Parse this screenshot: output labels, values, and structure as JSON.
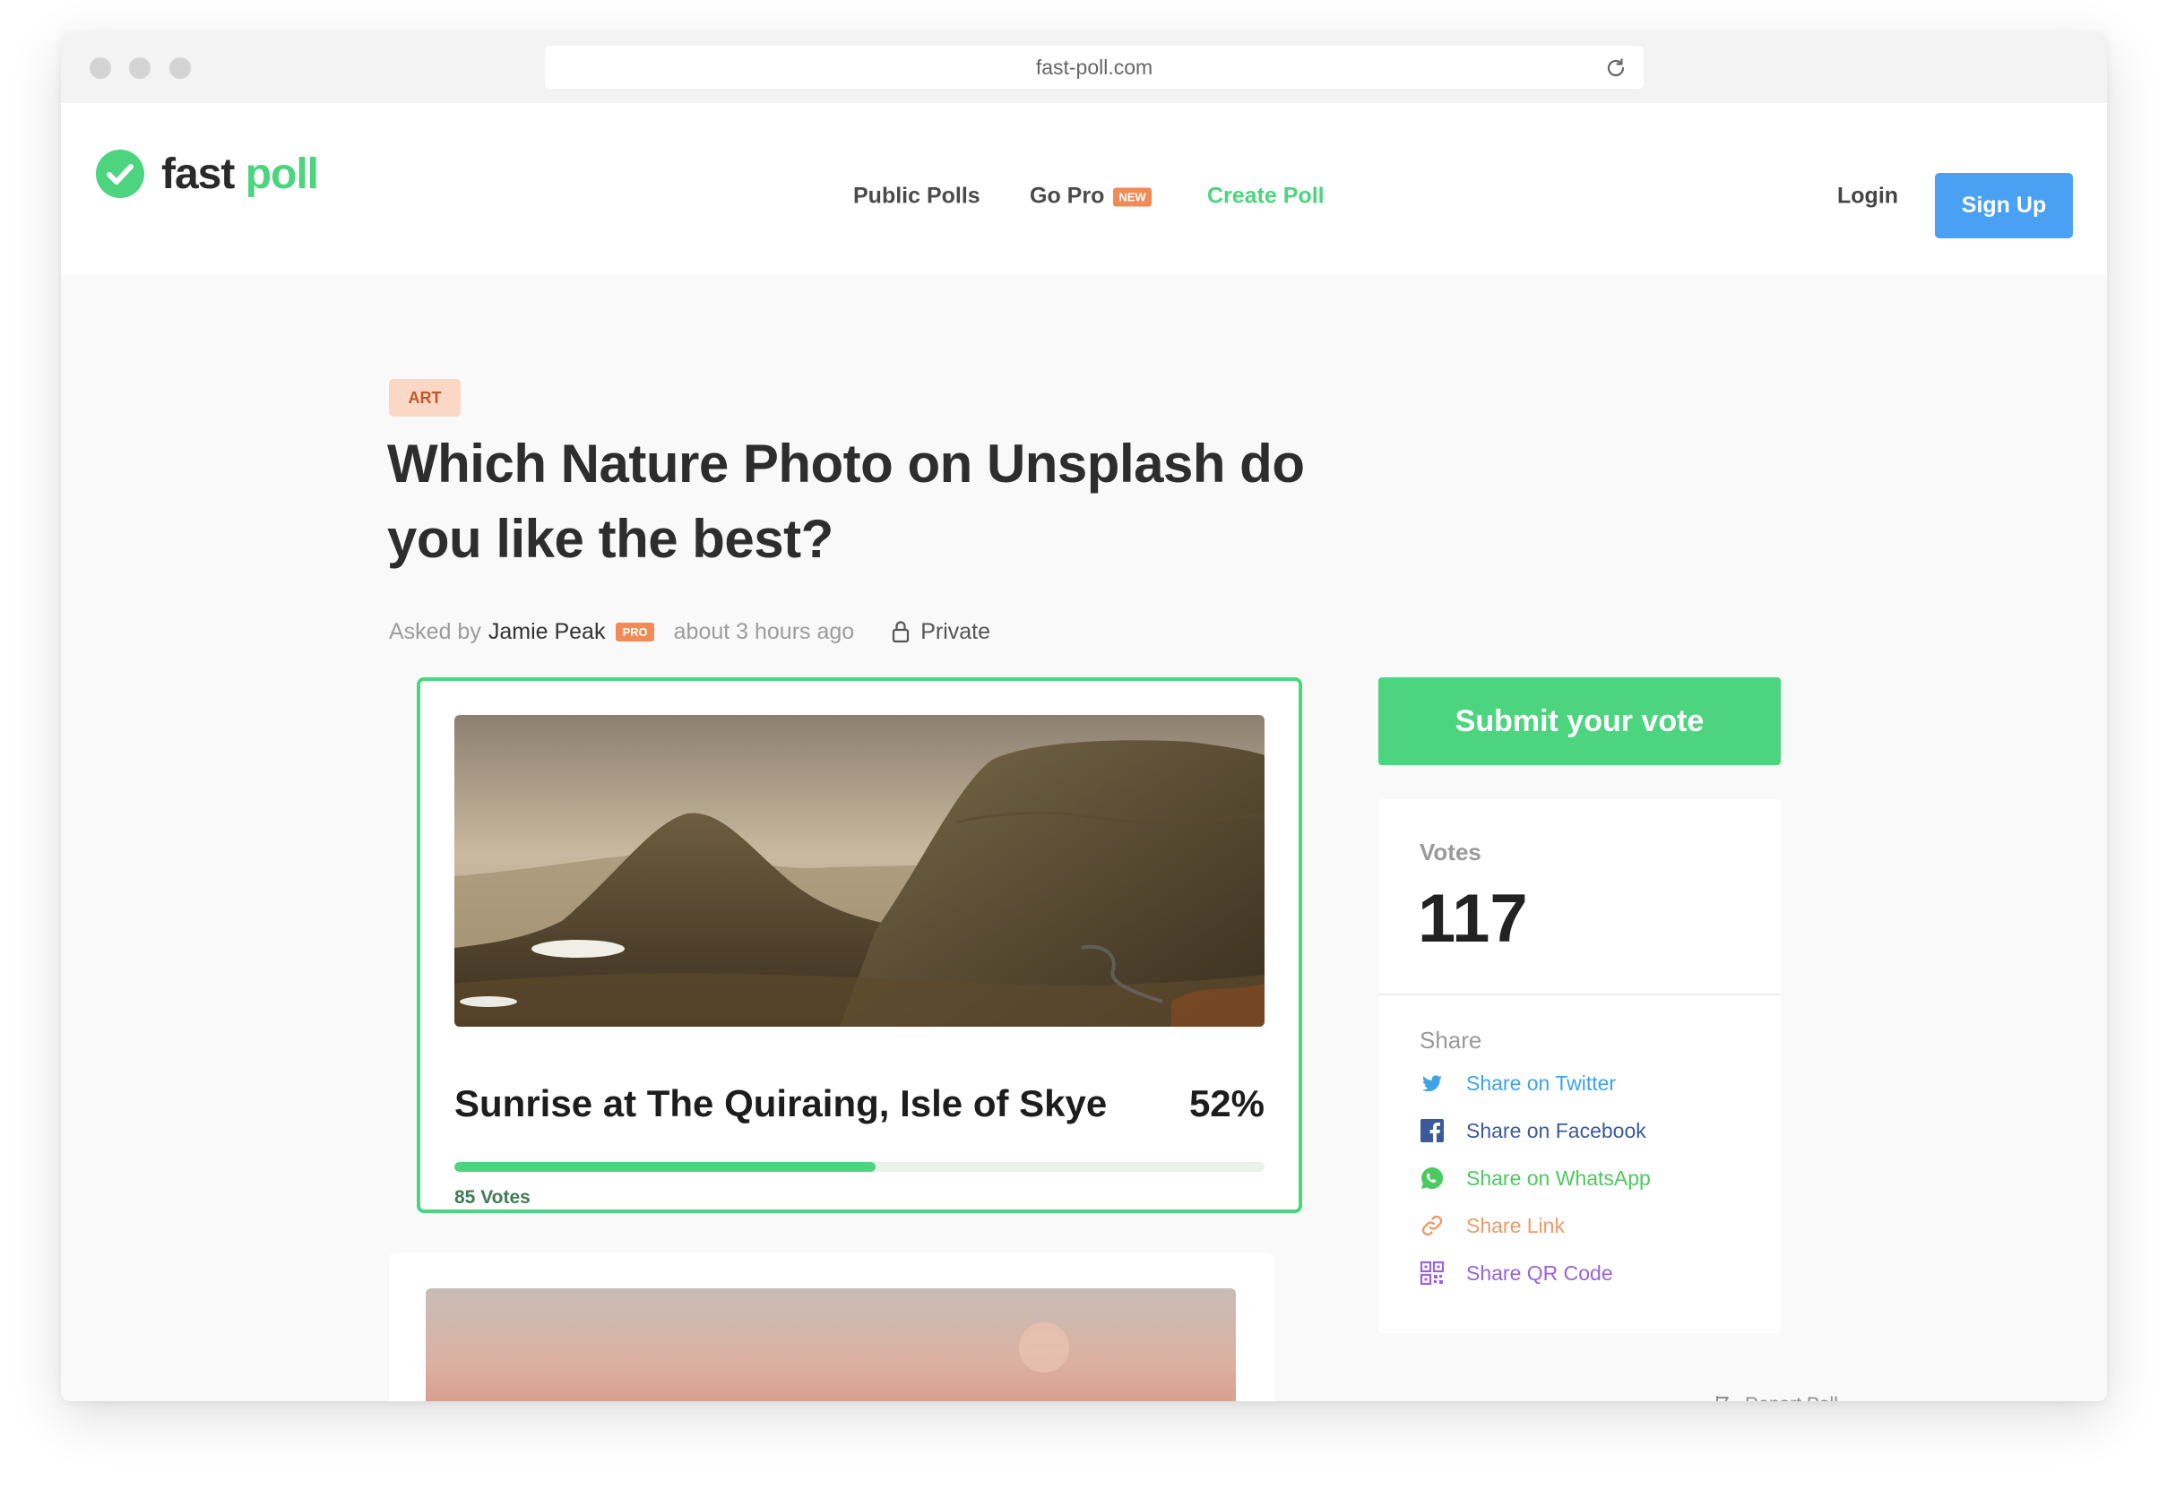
{
  "browser": {
    "url": "fast-poll.com"
  },
  "header": {
    "logo_fast": "fast",
    "logo_poll": "poll",
    "nav": {
      "public_polls": "Public Polls",
      "go_pro": "Go Pro",
      "go_pro_badge": "NEW",
      "create_poll": "Create Poll"
    },
    "login": "Login",
    "signup": "Sign Up"
  },
  "poll": {
    "category": "ART",
    "title": "Which Nature Photo on Unsplash do you like the best?",
    "asked_by_label": "Asked by",
    "author": "Jamie Peak",
    "author_badge": "PRO",
    "time": "about 3 hours ago",
    "visibility": "Private",
    "options": [
      {
        "label": "Sunrise at The Quiraing, Isle of Skye",
        "percent_label": "52%",
        "percent": 52,
        "votes_label": "85 Votes"
      }
    ]
  },
  "sidebar": {
    "submit": "Submit your vote",
    "votes_label": "Votes",
    "votes_count": "117",
    "share_label": "Share",
    "share": [
      {
        "label": "Share on Twitter",
        "icon": "twitter-icon",
        "color": "#3fa3e6"
      },
      {
        "label": "Share on Facebook",
        "icon": "facebook-icon",
        "color": "#3b5a9a"
      },
      {
        "label": "Share on WhatsApp",
        "icon": "whatsapp-icon",
        "color": "#4cc95f"
      },
      {
        "label": "Share Link",
        "icon": "link-icon",
        "color": "#ee9a68"
      },
      {
        "label": "Share QR Code",
        "icon": "qr-code-icon",
        "color": "#9a62dc"
      }
    ],
    "report": "Report Poll"
  },
  "colors": {
    "brand_green": "#4cd47f",
    "signup_blue": "#4aa1f3",
    "tag_bg": "#fbd8c6"
  }
}
